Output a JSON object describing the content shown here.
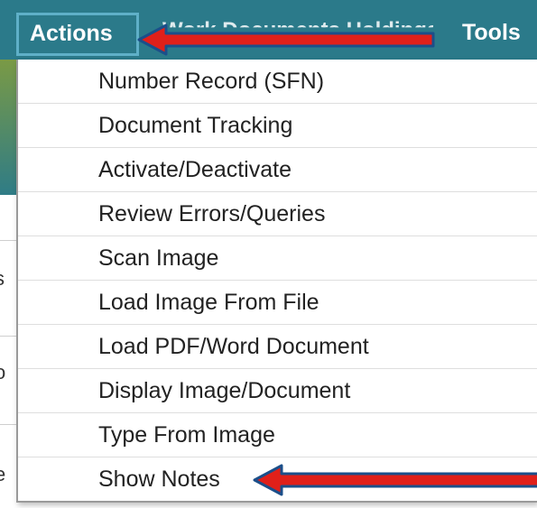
{
  "menubar": {
    "actions_label": "Actions",
    "hidden_label": "Work Documents Holdings",
    "tools_label": "Tools"
  },
  "dropdown": {
    "items": [
      {
        "label": "Number Record (SFN)"
      },
      {
        "label": "Document Tracking"
      },
      {
        "label": "Activate/Deactivate"
      },
      {
        "label": "Review Errors/Queries"
      },
      {
        "label": "Scan Image"
      },
      {
        "label": "Load Image From File"
      },
      {
        "label": "Load PDF/Word Document"
      },
      {
        "label": "Display Image/Document"
      },
      {
        "label": "Type From Image"
      },
      {
        "label": "Show Notes"
      }
    ]
  },
  "background": {
    "fragments": [
      "s",
      "o",
      "e"
    ]
  },
  "colors": {
    "menubar": "#2b7a8a",
    "arrow": "#e0201a",
    "arrow_outline": "#1b4f8a"
  }
}
